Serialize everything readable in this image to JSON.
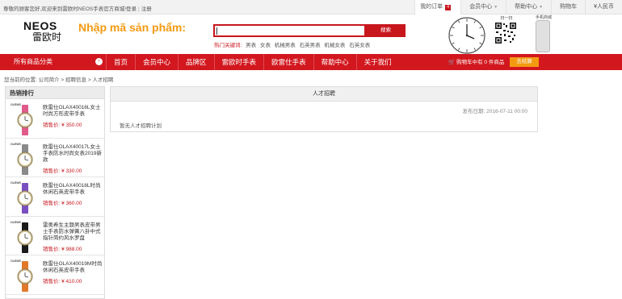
{
  "topbar": {
    "welcome": "尊敬的顾客您好,欢迎来到雷欧时NEOS手表官方商城!",
    "login": "登录",
    "register": "注册",
    "links": [
      {
        "label": "我的订单",
        "badge": "4"
      },
      {
        "label": "会员中心"
      },
      {
        "label": "帮助中心"
      },
      {
        "label": "购物车"
      },
      {
        "label": "¥人民币"
      }
    ]
  },
  "header": {
    "logo_en": "NEOS",
    "logo_cn": "雷欧时",
    "annotation": "Nhập mã sản phẩm:",
    "search_value": "",
    "search_button": "搜索",
    "hot_label": "热门关键词:",
    "hot_keywords": [
      "男表",
      "女表",
      "机械男表",
      "石英男表",
      "机械女表",
      "石英女表"
    ],
    "qr_title": "扫一扫",
    "phone_title": "手机商城"
  },
  "nav": {
    "all_categories": "所有商品分类",
    "arrow": "›",
    "items": [
      "首页",
      "会员中心",
      "品牌区",
      "雷欧时手表",
      "欧雷仕手表",
      "帮助中心",
      "关于我们"
    ],
    "cart_text": "购物车中有 0 件商品",
    "checkout": "去结算"
  },
  "breadcrumb": "您当前的位置: 公司简介 > 招聘信息 > 人才招聘",
  "sidebar": {
    "title": "热销排行",
    "products": [
      {
        "brand": "OLEWS",
        "name": "欧雷仕OLAX40016L女士时尚方形皮带手表",
        "price": "销售价: ¥ 350.00",
        "color": "#e05a8a"
      },
      {
        "brand": "OLEWS",
        "name": "欧雷仕OLAX40017L女士手表防水时尚女表2019新款",
        "price": "销售价: ¥ 330.00",
        "color": "#8a8a8a"
      },
      {
        "brand": "OLEWS",
        "name": "欧雷仕OLAX40018L时尚休闲石英皮带手表",
        "price": "销售价: ¥ 360.00",
        "color": "#7a4fc0"
      },
      {
        "brand": "OLEWS",
        "name": "雷奥希生主题男表皮带男士手表防水弹簧八卦中式指针简约风水罗盘",
        "price": "销售价: ¥ 988.00",
        "color": "#1a1a1a"
      },
      {
        "brand": "OLEWS",
        "name": "欧雷仕OLAX40019M时尚休闲石英皮带手表",
        "price": "销售价: ¥ 410.00",
        "color": "#e07a2a"
      }
    ]
  },
  "main": {
    "title": "人才招聘",
    "date": "发布日期: 2016-07-11 00:00",
    "content": "暂无人才招聘计划"
  }
}
